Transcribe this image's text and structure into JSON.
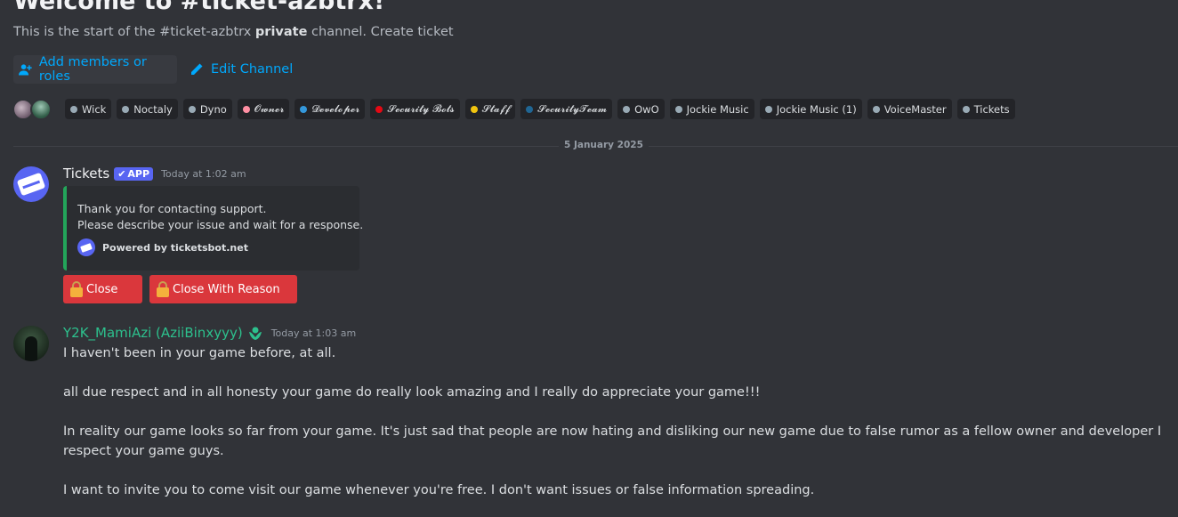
{
  "channel": {
    "welcome_title": "Welcome to #ticket-azbtrx!",
    "sub_prefix": "This is the start of the #ticket-azbtrx ",
    "sub_bold": "private",
    "sub_suffix": " channel. Create ticket",
    "add_members_label": "Add members or roles",
    "edit_channel_label": "Edit Channel"
  },
  "roles": [
    {
      "name": "Wick",
      "color": "#99aab5"
    },
    {
      "name": "Noctaly",
      "color": "#99aab5"
    },
    {
      "name": "Dyno",
      "color": "#99aab5"
    },
    {
      "name": "𝓞𝔀𝓷𝓮𝓻",
      "color": "#ff8fa3"
    },
    {
      "name": "𝓓𝓮𝓿𝓮𝓵𝓸𝓹𝓮𝓻",
      "color": "#3498db"
    },
    {
      "name": "𝓢𝓮𝓬𝓾𝓻𝓲𝓽𝔂 𝓑𝓸𝓽𝓼",
      "color": "#e50914"
    },
    {
      "name": "𝓢𝓽𝓪𝓯𝓯",
      "color": "#f1c40f"
    },
    {
      "name": "𝓢𝓮𝓬𝓾𝓻𝓲𝓽𝔂𝓣𝓮𝓪𝓶",
      "color": "#206694"
    },
    {
      "name": "OwO",
      "color": "#99aab5"
    },
    {
      "name": "Jockie Music",
      "color": "#99aab5"
    },
    {
      "name": "Jockie Music (1)",
      "color": "#99aab5"
    },
    {
      "name": "VoiceMaster",
      "color": "#99aab5"
    },
    {
      "name": "Tickets",
      "color": "#99aab5"
    }
  ],
  "date_divider": "5 January 2025",
  "messages": [
    {
      "author": "Tickets",
      "badge": "APP",
      "timestamp": "Today at 1:02 am",
      "embed": {
        "line1": "Thank you for contacting support.",
        "line2": "Please describe your issue and wait for a response.",
        "footer": "Powered by ticketsbot.net",
        "accent": "#23a55a"
      },
      "buttons": [
        {
          "label": "Close"
        },
        {
          "label": "Close With Reason"
        }
      ]
    },
    {
      "author": "Y2K_MamiAzi (AziiBinxyyy)",
      "timestamp": "Today at 1:03 am",
      "paragraphs": [
        "I haven't been in your game before, at all.",
        "all due respect and in all honesty your game do really look amazing and I really do appreciate your game!!!",
        "In reality our game looks so far from your game. It's just sad that people are now hating and disliking our new game due to false rumor as a fellow owner and developer I respect your game guys.",
        "I want to invite you to come visit our game whenever you're free. I don't want issues or false information spreading."
      ]
    }
  ]
}
